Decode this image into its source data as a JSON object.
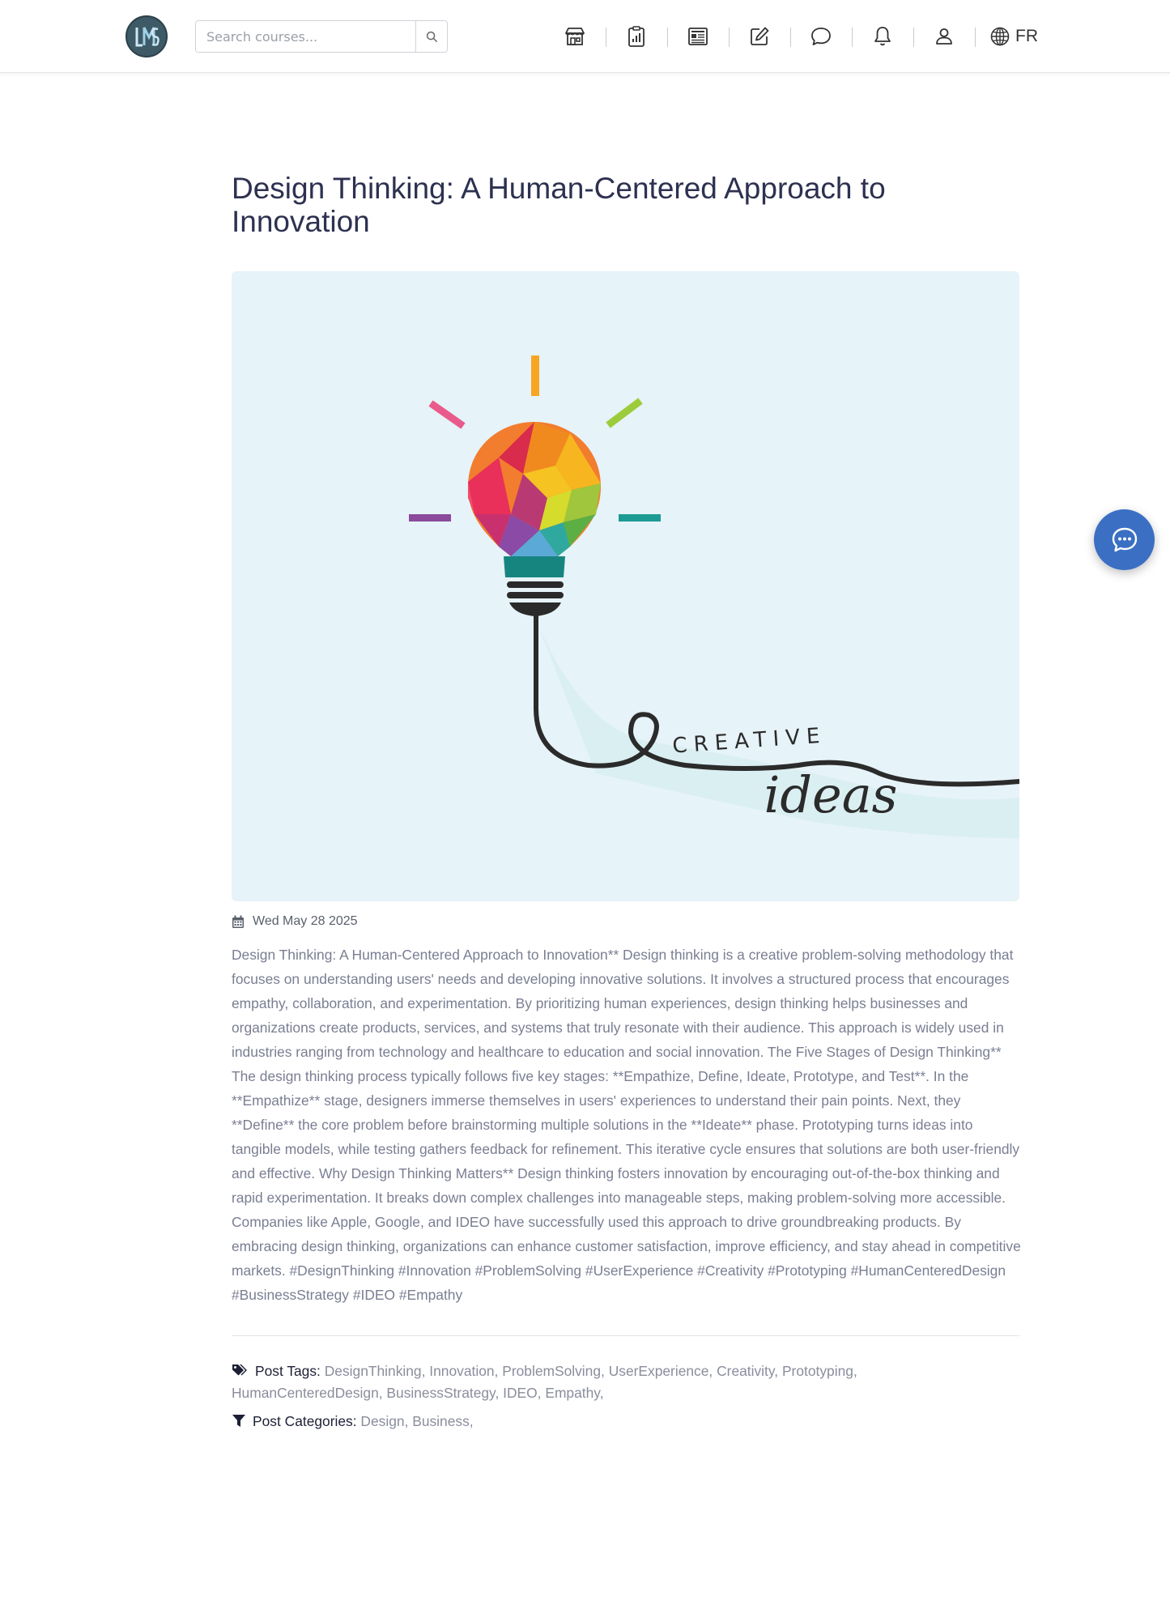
{
  "header": {
    "logo_text": "LMS",
    "search": {
      "placeholder": "Search courses..."
    },
    "nav_icons": [
      "store-icon",
      "clipboard-chart-icon",
      "newspaper-icon",
      "edit-icon",
      "chat-icon",
      "bell-icon",
      "user-icon",
      "globe-icon"
    ],
    "language": "FR"
  },
  "article": {
    "title": "Design Thinking: A Human-Centered Approach to Innovation",
    "hero": {
      "word_top": "CREATIVE",
      "word_bottom": "ideas"
    },
    "date": "Wed May 28 2025",
    "body": "Design Thinking: A Human-Centered Approach to Innovation** Design thinking is a creative problem-solving methodology that focuses on understanding users' needs and developing innovative solutions. It involves a structured process that encourages empathy, collaboration, and experimentation. By prioritizing human experiences, design thinking helps businesses and organizations create products, services, and systems that truly resonate with their audience. This approach is widely used in industries ranging from technology and healthcare to education and social innovation. The Five Stages of Design Thinking** The design thinking process typically follows five key stages: **Empathize, Define, Ideate, Prototype, and Test**. In the **Empathize** stage, designers immerse themselves in users' experiences to understand their pain points. Next, they **Define** the core problem before brainstorming multiple solutions in the **Ideate** phase. Prototyping turns ideas into tangible models, while testing gathers feedback for refinement. This iterative cycle ensures that solutions are both user-friendly and effective. Why Design Thinking Matters** Design thinking fosters innovation by encouraging out-of-the-box thinking and rapid experimentation. It breaks down complex challenges into manageable steps, making problem-solving more accessible. Companies like Apple, Google, and IDEO have successfully used this approach to drive groundbreaking products. By embracing design thinking, organizations can enhance customer satisfaction, improve efficiency, and stay ahead in competitive markets. #DesignThinking #Innovation #ProblemSolving #UserExperience #Creativity #Prototyping #HumanCenteredDesign #BusinessStrategy #IDEO #Empathy",
    "tags_label": "Post Tags:",
    "tags": [
      "DesignThinking",
      "Innovation",
      "ProblemSolving",
      "UserExperience",
      "Creativity",
      "Prototyping",
      "HumanCenteredDesign",
      "BusinessStrategy",
      "IDEO",
      "Empathy"
    ],
    "categories_label": "Post Categories:",
    "categories": [
      "Design",
      "Business"
    ]
  },
  "colors": {
    "accent": "#3a6fc4",
    "title": "#2d3150",
    "body_text": "#7a7e92",
    "hero_bg": "#e6f3f8"
  },
  "fab_icon": "chat-dots-icon"
}
